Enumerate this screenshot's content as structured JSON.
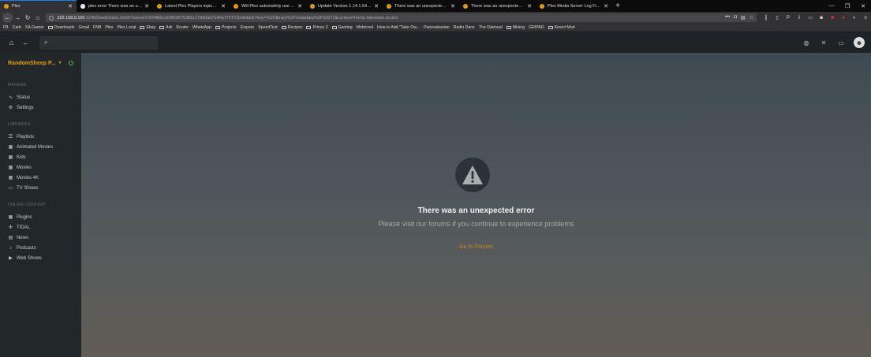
{
  "browser": {
    "tabs": [
      {
        "label": "Plex",
        "icon": "plex-icon",
        "active": true
      },
      {
        "label": "plex error There was an unexpected error",
        "icon": "google-icon"
      },
      {
        "label": "Latest Plex Players topics - Plex",
        "icon": "plex-icon"
      },
      {
        "label": "Will Plex automaticly use my server",
        "icon": "plex-icon"
      },
      {
        "label": "Update Version 1.14.1.5488 Error",
        "icon": "plex-icon"
      },
      {
        "label": "There was an unexpected error",
        "icon": "plex-icon"
      },
      {
        "label": "There was an unexpected error",
        "icon": "plex-icon"
      },
      {
        "label": "Plex Media Server Log Files | Plex",
        "icon": "plex-icon"
      }
    ],
    "new_tab": "+",
    "window_controls": [
      "—",
      "❐",
      "✕"
    ],
    "url": {
      "host": "192.168.0.100",
      "rest": ":32400/web/index.html#!/server/c904f58cc608236753b5c17dd0ab7a40a770721b/details?key=%2Flibrary%2Fmetadata%2F52072&context=home.television.recent"
    },
    "bookmarks": [
      "FB",
      "Carb",
      "SA Gamer",
      "Downloads",
      "Gmail",
      "FNB",
      "Plex",
      "Plex Local",
      "Ebay",
      "Arb",
      "Router",
      "WhatsApp",
      "Projects",
      "Esquire",
      "SpeedTest",
      "Recipes",
      "Prince 2",
      "Gaming",
      "Mobicred",
      "How to Add \"Take Ow...",
      "Parisvakanian",
      "Radio Danz",
      "The Oatmeal",
      "Mining",
      "GRIPAD",
      "Kinect Mod"
    ]
  },
  "plex": {
    "search_placeholder": "",
    "server_name": "RandomSheep P...",
    "sections": {
      "manage": "MANAGE",
      "libraries": "LIBRARIES",
      "online": "ONLINE CONTENT"
    },
    "manage_items": [
      {
        "label": "Status",
        "icon": "pulse-icon"
      },
      {
        "label": "Settings",
        "icon": "gear-icon"
      }
    ],
    "library_items": [
      {
        "label": "Playlists",
        "icon": "list-icon"
      },
      {
        "label": "Animated Movies",
        "icon": "film-icon"
      },
      {
        "label": "Kids",
        "icon": "film-icon"
      },
      {
        "label": "Movies",
        "icon": "film-icon"
      },
      {
        "label": "Movies 4K",
        "icon": "film-icon"
      },
      {
        "label": "TV Shows",
        "icon": "tv-icon"
      }
    ],
    "online_items": [
      {
        "label": "Plugins",
        "icon": "grid-icon"
      },
      {
        "label": "TIDAL",
        "icon": "tidal-icon"
      },
      {
        "label": "News",
        "icon": "news-icon"
      },
      {
        "label": "Podcasts",
        "icon": "microphone-icon"
      },
      {
        "label": "Web Shows",
        "icon": "play-icon"
      }
    ],
    "error": {
      "title": "There was an unexpected error",
      "subtitle": "Please visit our forums if you continue to experience problems",
      "link": "Go to Forums"
    }
  },
  "colors": {
    "accent": "#e5a00d",
    "link": "#cc8a19",
    "sidebar": "#22272a",
    "topbar": "#1f2326"
  }
}
